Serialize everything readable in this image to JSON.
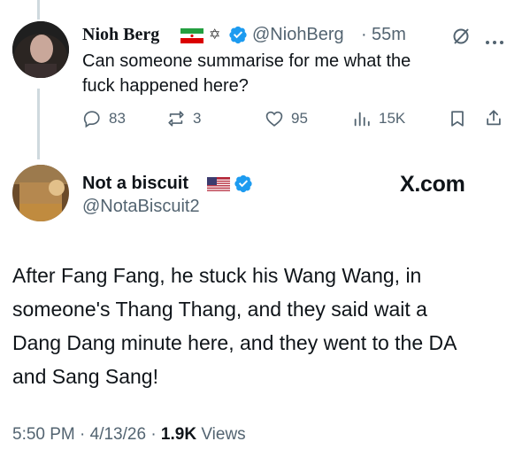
{
  "reply_tweet": {
    "display_name": "Nioh Berg",
    "name_emojis": "✡",
    "handle": "@NiohBerg",
    "separator": "·",
    "age": "55m",
    "text_line1": "Can someone summarise for me what the",
    "text_line2": "fuck happened here?",
    "actions": {
      "replies": "83",
      "reposts": "3",
      "likes": "95",
      "views": "15K"
    }
  },
  "main_tweet": {
    "display_name": "Not a biscuit",
    "handle": "@NotaBiscuit2",
    "watermark": "X.com",
    "body_lines": [
      "After Fang Fang, he stuck his Wang Wang, in",
      "someone's Thang Thang, and they said wait a",
      "Dang Dang minute here, and they went to the DA",
      "and Sang Sang!"
    ],
    "timestamp": "5:50 PM · 4/13/26 · ",
    "views_count": "1.9K",
    "views_label": " Views"
  },
  "colors": {
    "verified": "#1d9bf0",
    "secondary_text": "#536471",
    "thread_line": "#cfd9de"
  }
}
